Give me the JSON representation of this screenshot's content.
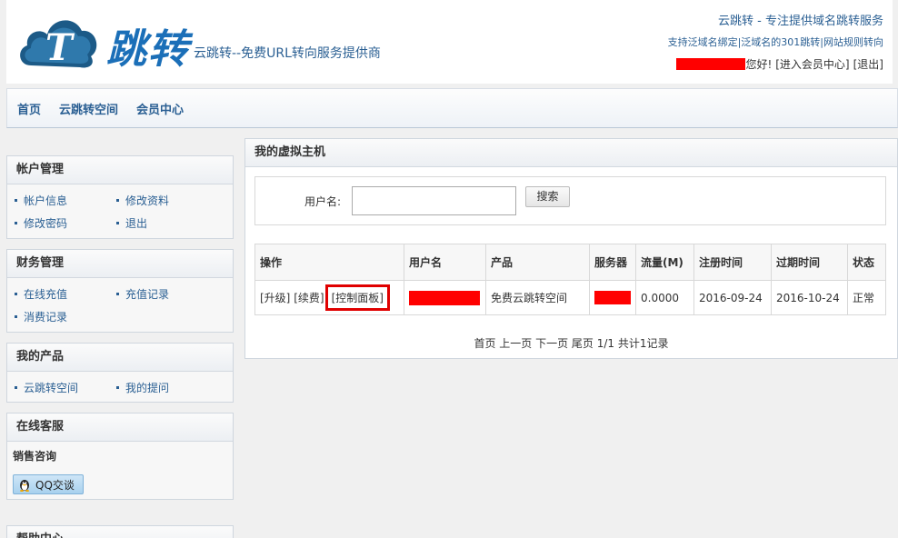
{
  "header": {
    "logo_letter": "T",
    "logo_title": "跳转",
    "slogan": "云跳转--免费URL转向服务提供商",
    "tagline": "云跳转 - 专注提供域名跳转服务",
    "features": "支持泛域名绑定|泛域名的301跳转|网站规则转向",
    "greeting": "您好!",
    "member_link": "[进入会员中心]",
    "logout_link": "[退出]"
  },
  "nav": [
    "首页",
    "云跳转空间",
    "会员中心"
  ],
  "sidebar": {
    "account": {
      "title": "帐户管理",
      "items": [
        "帐户信息",
        "修改资料",
        "修改密码",
        "退出"
      ]
    },
    "finance": {
      "title": "财务管理",
      "items": [
        "在线充值",
        "充值记录",
        "消费记录"
      ]
    },
    "products": {
      "title": "我的产品",
      "items": [
        "云跳转空间",
        "我的提问"
      ]
    },
    "support": {
      "title": "在线客服",
      "sales_label": "销售咨询",
      "qq_label": "QQ交谈"
    },
    "help": {
      "title": "帮助中心"
    }
  },
  "main": {
    "title": "我的虚拟主机",
    "search_label": "用户名:",
    "search_value": "",
    "search_button": "搜索",
    "columns": [
      "操作",
      "用户名",
      "产品",
      "服务器",
      "流量(M)",
      "注册时间",
      "过期时间",
      "状态"
    ],
    "row": {
      "op_upgrade": "[升级]",
      "op_renew": "[续费]",
      "op_panel": "[控制面板]",
      "product": "免费云跳转空间",
      "traffic": "0.0000",
      "reg_date": "2016-09-24",
      "exp_date": "2016-10-24",
      "status": "正常"
    },
    "pager": "首页 上一页 下一页 尾页 1/1  共计1记录"
  },
  "colors": {
    "link": "#2a5f93",
    "redaction": "#ff0000",
    "highlight_box": "#e00000"
  }
}
